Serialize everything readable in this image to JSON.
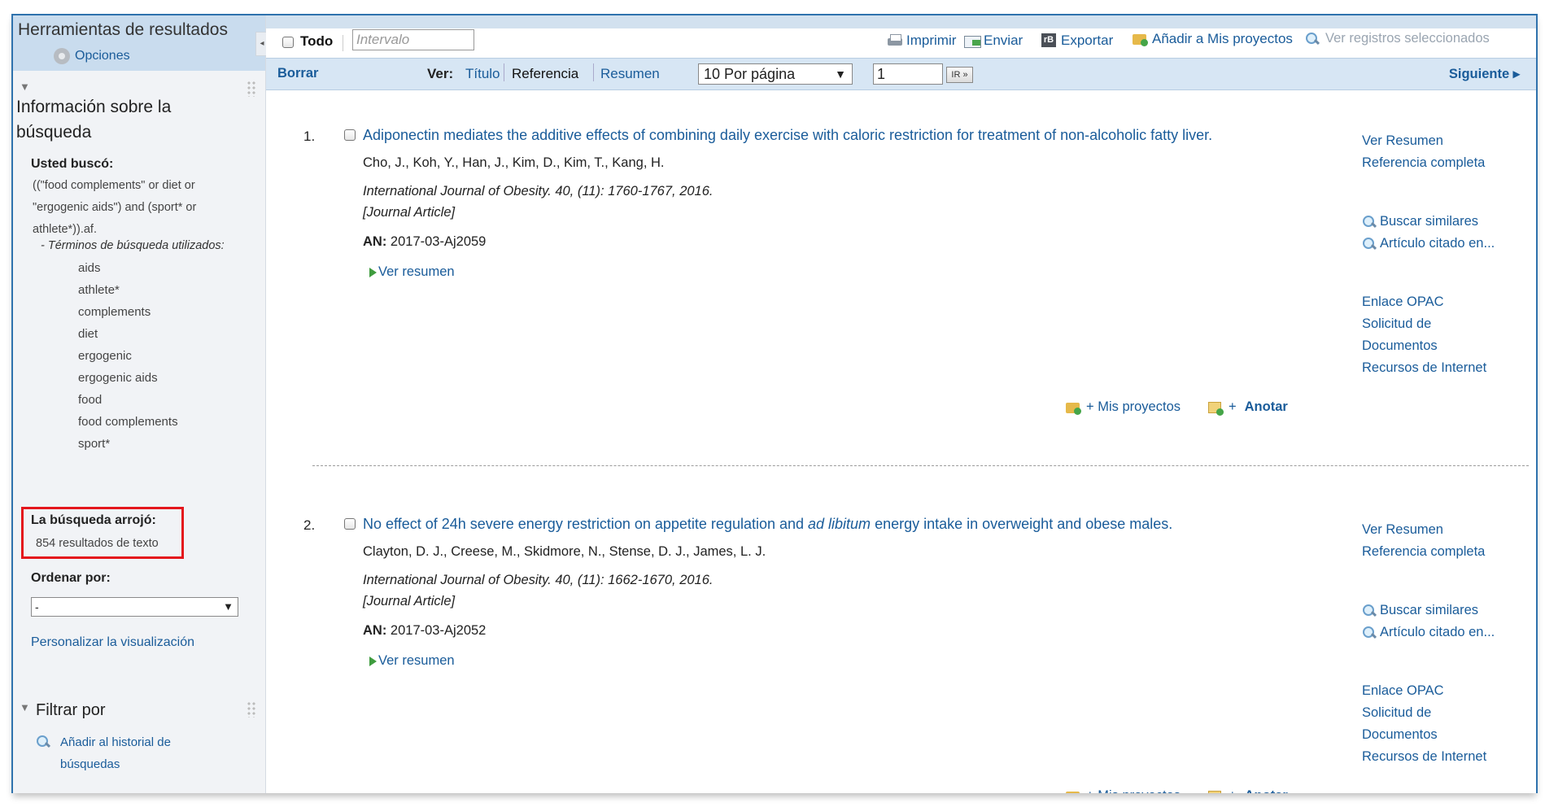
{
  "sidebar": {
    "title": "Herramientas de resultados",
    "options_label": "Opciones",
    "collapse_glyph": "◂",
    "search_info_heading_1": "Información sobre la",
    "search_info_heading_2": "búsqueda",
    "you_searched_label": "Usted buscó:",
    "query_lines": [
      "((\"food complements\" or diet or",
      "\"ergogenic aids\") and (sport* or",
      "athlete*)).af."
    ],
    "terms_title": "- Términos de búsqueda utilizados:",
    "terms": [
      "aids",
      "athlete*",
      "complements",
      "diet",
      "ergogenic",
      "ergogenic aids",
      "food",
      "food complements",
      "sport*"
    ],
    "result_label": "La búsqueda arrojó:",
    "result_text": "854 resultados de texto",
    "sort_label": "Ordenar por:",
    "sort_value": "-",
    "customize_link": "Personalizar la visualización",
    "filter_heading": "Filtrar por",
    "add_history_line1": "Añadir al historial de",
    "add_history_line2": "búsquedas"
  },
  "toolbar": {
    "all_label": "Todo",
    "interval_placeholder": "Intervalo",
    "print": "Imprimir",
    "send": "Enviar",
    "export": "Exportar",
    "add_projects": "Añadir a Mis proyectos",
    "view_selected": "Ver registros seleccionados",
    "clear": "Borrar",
    "view_label": "Ver:",
    "view_title": "Título",
    "view_reference": "Referencia",
    "view_abstract": "Resumen",
    "per_page": "10 Por página",
    "page_number": "1",
    "go_label": "IR »",
    "next": "Siguiente ▸"
  },
  "records": [
    {
      "num": "1.",
      "title": "Adiponectin mediates the additive effects of combining daily exercise with caloric restriction for treatment of non-alcoholic fatty liver.",
      "authors": "Cho, J., Koh, Y., Han, J., Kim, D., Kim, T., Kang, H.",
      "journal": "International Journal of Obesity. 40, (11): 1760-1767, 2016.",
      "type": "[Journal Article]",
      "an_label": "AN:",
      "an_value": "2017-03-Aj2059",
      "view_abstract": "Ver resumen"
    },
    {
      "num": "2.",
      "title_part1": "No effect of 24h severe energy restriction on appetite regulation and ",
      "title_italic": "ad libitum",
      "title_part2": " energy intake in overweight and obese males.",
      "authors": "Clayton, D. J., Creese, M., Skidmore, N., Stense, D. J., James, L. J.",
      "journal": "International Journal of Obesity. 40, (11): 1662-1670, 2016.",
      "type": "[Journal Article]",
      "an_label": "AN:",
      "an_value": "2017-03-Aj2052",
      "view_abstract": "Ver resumen"
    }
  ],
  "record_links": {
    "view_abstract": "Ver Resumen",
    "full_reference": "Referencia completa",
    "find_similar": "Buscar similares",
    "cited_article": "Artículo citado en...",
    "opac_link": "Enlace OPAC",
    "doc_request_1": "Solicitud de",
    "doc_request_2": "Documentos",
    "internet_resources": "Recursos de Internet",
    "my_projects": "+ Mis proyectos",
    "annotate_plus": "+",
    "annotate": "Anotar"
  },
  "colors": {
    "link": "#1a5c9a",
    "highlight_border": "#e4161c",
    "toolbar_bg": "#d7e6f4",
    "sidebar_header_bg": "#c9dcee"
  }
}
